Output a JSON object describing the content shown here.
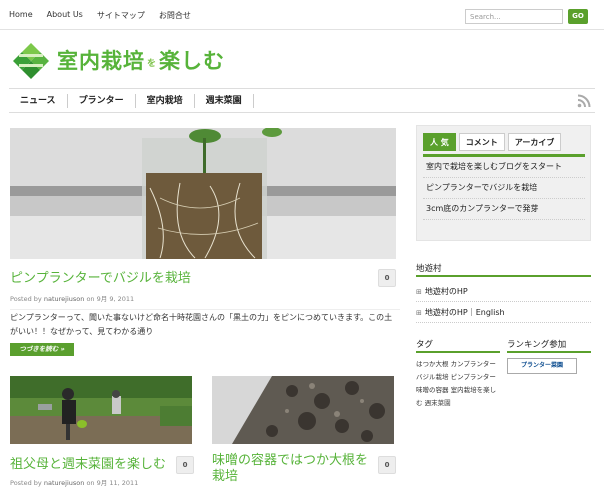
{
  "topnav": [
    "Home",
    "About Us",
    "サイトマップ",
    "お問合せ"
  ],
  "search": {
    "placeholder": "Search...",
    "go_label": "GO"
  },
  "logo": {
    "main": "室内栽培",
    "small": "を",
    "sub": "楽しむ"
  },
  "mainnav": [
    "ニュース",
    "プランター",
    "室内栽培",
    "週末菜園"
  ],
  "featured": {
    "title": "ピンプランターでバジルを栽培",
    "comments": "0",
    "meta_prefix": "Posted by",
    "author": "naturejiuson",
    "meta_on": "on",
    "date": "9月 9, 2011",
    "excerpt": "ピンプランターって、聞いた事ないけど命名十時花園さんの「黒土の力」をピンにつめていきます。この土がいい！！なぜかって、見てわかる通り",
    "readmore": "つづきを読む »"
  },
  "posts": [
    {
      "title": "祖父母と週末菜園を楽しむ",
      "comments": "0",
      "author": "naturejiuson",
      "date": "9月 11, 2011"
    },
    {
      "title": "味噌の容器ではつか大根を栽培",
      "comments": "0"
    }
  ],
  "sidebar": {
    "tabs": [
      "人 気",
      "コメント",
      "アーカイブ"
    ],
    "popular": [
      "室内で栽培を楽しむブログをスタート",
      "ピンプランターでバジルを栽培",
      "3cm底のカンプランターで発芽"
    ],
    "chiyu_title": "地遊村",
    "chiyu_links": [
      "地遊村のHP",
      "地遊村のHP｜English"
    ],
    "tags_title": "タグ",
    "tags": "はつか大根 カンプランター バジル栽培 ピンプランター 味噌の容器 室内栽培を楽しむ 週末菜園",
    "ranking_title": "ランキング参加",
    "ranking_banner": "プランター菜園"
  },
  "colors": {
    "accent": "#5aa02c",
    "title_green": "#57b33a"
  }
}
